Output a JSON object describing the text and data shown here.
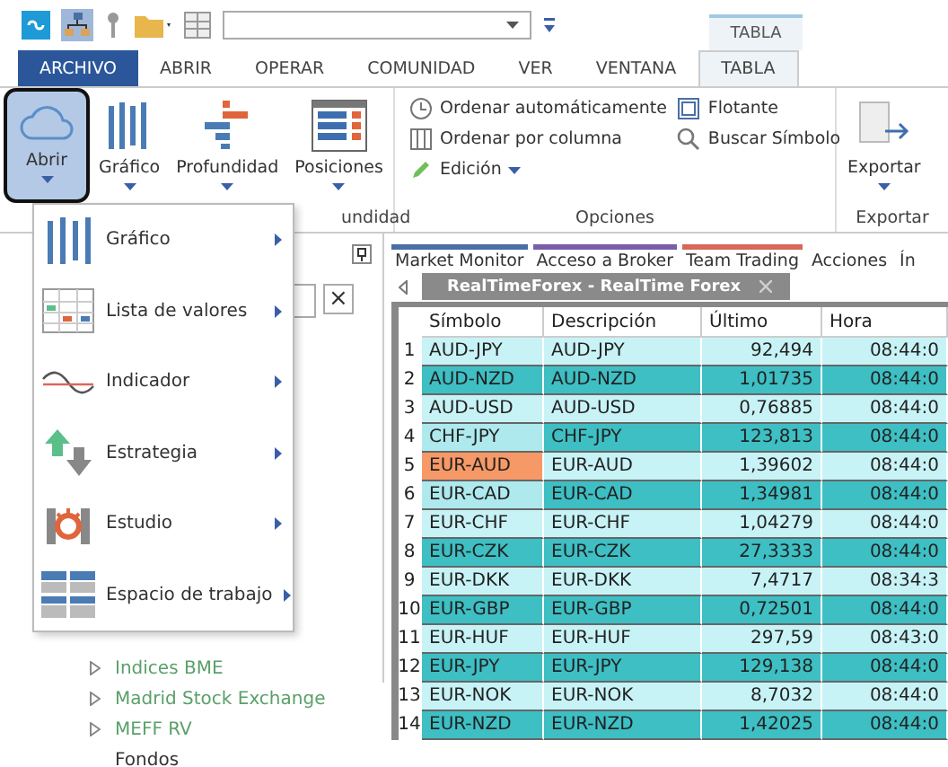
{
  "context_tab": "TABLA",
  "tabs": [
    {
      "label": "ARCHIVO",
      "kind": "file",
      "selected": false
    },
    {
      "label": "ABRIR",
      "kind": "tab",
      "selected": false
    },
    {
      "label": "OPERAR",
      "kind": "tab",
      "selected": false
    },
    {
      "label": "COMUNIDAD",
      "kind": "tab",
      "selected": false
    },
    {
      "label": "VER",
      "kind": "tab",
      "selected": false
    },
    {
      "label": "VENTANA",
      "kind": "tab",
      "selected": false
    },
    {
      "label": "TABLA",
      "kind": "tab",
      "selected": true
    }
  ],
  "ribbon": {
    "big_buttons": [
      {
        "label": "Abrir",
        "selected": true
      },
      {
        "label": "Gráfico",
        "selected": false
      },
      {
        "label": "Profundidad",
        "selected": false
      },
      {
        "label": "Posiciones",
        "selected": false
      }
    ],
    "group_label_1": "undidad",
    "options": [
      {
        "label": "Ordenar automáticamente"
      },
      {
        "label": "Ordenar por columna"
      },
      {
        "label": "Edición"
      },
      {
        "label": "Flotante"
      },
      {
        "label": "Buscar Símbolo"
      }
    ],
    "group_label_2": "Opciones",
    "export_button": "Exportar",
    "group_label_3": "Exportar"
  },
  "menu": [
    {
      "label": "Gráfico"
    },
    {
      "label": "Lista de valores"
    },
    {
      "label": "Indicador"
    },
    {
      "label": "Estrategia"
    },
    {
      "label": "Estudio"
    },
    {
      "label": "Espacio de trabajo"
    }
  ],
  "left_pane": {
    "clear_button": "×",
    "tree": [
      {
        "label": "Indices BME",
        "kind": "folder"
      },
      {
        "label": "Madrid Stock Exchange",
        "kind": "folder"
      },
      {
        "label": "MEFF RV",
        "kind": "folder"
      },
      {
        "label": "Fondos",
        "kind": "leaf"
      }
    ]
  },
  "pane_tabs": [
    {
      "label": "Market Monitor",
      "color": "#4a6fa5"
    },
    {
      "label": "Acceso a Broker",
      "color": "#7b5ea8"
    },
    {
      "label": "Team Trading",
      "color": "#d9675a"
    },
    {
      "label": "Acciones"
    },
    {
      "label": "Ín"
    }
  ],
  "doc_tab": "RealTimeForex - RealTime Forex",
  "table": {
    "columns": [
      "Símbolo",
      "Descripción",
      "Último",
      "Hora"
    ],
    "rows": [
      {
        "n": "1",
        "symbol": {
          "text": "AUD-JPY",
          "color": "#c8f3f6"
        },
        "description": "AUD-JPY",
        "last": "92,494",
        "time": "08:44:0",
        "color": "#c8f3f6"
      },
      {
        "n": "2",
        "symbol": {
          "text": "AUD-NZD",
          "color": "#3dbfc4"
        },
        "description": "AUD-NZD",
        "last": "1,01735",
        "time": "08:44:0",
        "color": "#3dbfc4"
      },
      {
        "n": "3",
        "symbol": {
          "text": "AUD-USD",
          "color": "#c8f3f6"
        },
        "description": "AUD-USD",
        "last": "0,76885",
        "time": "08:44:0",
        "color": "#c8f3f6"
      },
      {
        "n": "4",
        "symbol": {
          "text": "CHF-JPY",
          "color": "#aee9ee"
        },
        "description": "CHF-JPY",
        "last": "123,813",
        "time": "08:44:0",
        "color": "#3dbfc4"
      },
      {
        "n": "5",
        "symbol": {
          "text": "EUR-AUD",
          "color": "#f79966"
        },
        "description": "EUR-AUD",
        "last": "1,39602",
        "time": "08:44:0",
        "color": "#c8f3f6"
      },
      {
        "n": "6",
        "symbol": {
          "text": "EUR-CAD",
          "color": "#aee9ee"
        },
        "description": "EUR-CAD",
        "last": "1,34981",
        "time": "08:44:0",
        "color": "#3dbfc4"
      },
      {
        "n": "7",
        "symbol": {
          "text": "EUR-CHF",
          "color": "#c8f3f6"
        },
        "description": "EUR-CHF",
        "last": "1,04279",
        "time": "08:44:0",
        "color": "#c8f3f6"
      },
      {
        "n": "8",
        "symbol": {
          "text": "EUR-CZK",
          "color": "#3dbfc4"
        },
        "description": "EUR-CZK",
        "last": "27,3333",
        "time": "08:44:0",
        "color": "#3dbfc4"
      },
      {
        "n": "9",
        "symbol": {
          "text": "EUR-DKK",
          "color": "#c8f3f6"
        },
        "description": "EUR-DKK",
        "last": "7,4717",
        "time": "08:34:3",
        "color": "#c8f3f6"
      },
      {
        "n": "10",
        "symbol": {
          "text": "EUR-GBP",
          "color": "#3dbfc4"
        },
        "description": "EUR-GBP",
        "last": "0,72501",
        "time": "08:44:0",
        "color": "#3dbfc4"
      },
      {
        "n": "11",
        "symbol": {
          "text": "EUR-HUF",
          "color": "#c8f3f6"
        },
        "description": "EUR-HUF",
        "last": "297,59",
        "time": "08:43:0",
        "color": "#c8f3f6"
      },
      {
        "n": "12",
        "symbol": {
          "text": "EUR-JPY",
          "color": "#3dbfc4"
        },
        "description": "EUR-JPY",
        "last": "129,138",
        "time": "08:44:0",
        "color": "#3dbfc4"
      },
      {
        "n": "13",
        "symbol": {
          "text": "EUR-NOK",
          "color": "#c8f3f6"
        },
        "description": "EUR-NOK",
        "last": "8,7032",
        "time": "08:44:0",
        "color": "#c8f3f6"
      },
      {
        "n": "14",
        "symbol": {
          "text": "EUR-NZD",
          "color": "#3dbfc4"
        },
        "description": "EUR-NZD",
        "last": "1,42025",
        "time": "08:44:0",
        "color": "#3dbfc4"
      }
    ]
  }
}
